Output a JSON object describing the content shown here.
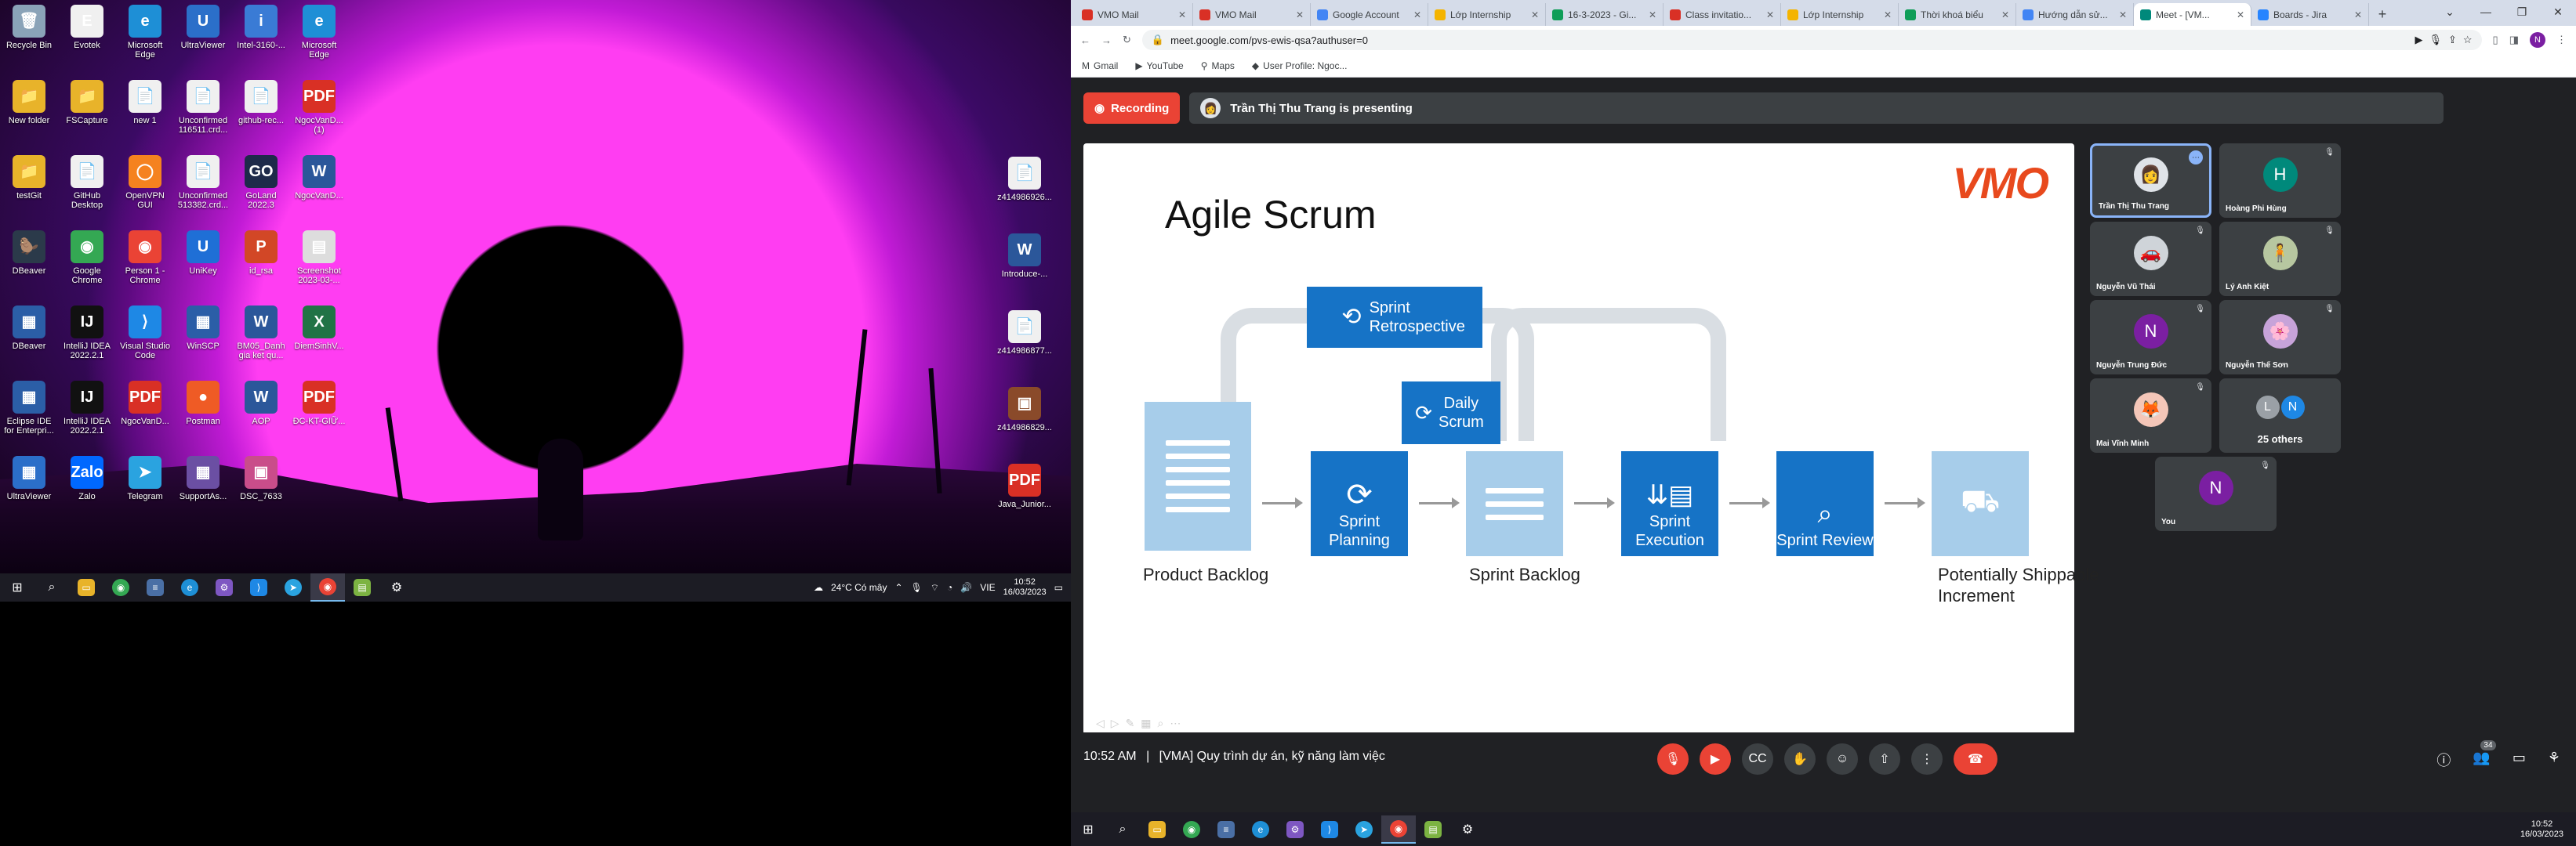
{
  "left_desktop": {
    "icons": [
      {
        "label": "Recycle Bin",
        "glyph": "🗑",
        "color": "#8aa3b8"
      },
      {
        "label": "Evotek",
        "glyph": "E",
        "color": "#f0f0f0"
      },
      {
        "label": "Microsoft Edge",
        "glyph": "e",
        "color": "#1e8fd6"
      },
      {
        "label": "UltraViewer",
        "glyph": "U",
        "color": "#2b6fc9"
      },
      {
        "label": "Intel-3160-...",
        "glyph": "i",
        "color": "#3a7bd5"
      },
      {
        "label": "Microsoft Edge",
        "glyph": "e",
        "color": "#1e8fd6"
      },
      {
        "label": "New folder",
        "glyph": "📁",
        "color": "#e8b32a"
      },
      {
        "label": "FSCapture",
        "glyph": "📁",
        "color": "#e8b32a"
      },
      {
        "label": "new 1",
        "glyph": "📄",
        "color": "#f0f0f0"
      },
      {
        "label": "Unconfirmed 116511.crd...",
        "glyph": "📄",
        "color": "#f0f0f0"
      },
      {
        "label": "github-rec...",
        "glyph": "📄",
        "color": "#f0f0f0"
      },
      {
        "label": "NgocVanD... (1)",
        "glyph": "PDF",
        "color": "#d93025"
      },
      {
        "label": "testGit",
        "glyph": "📁",
        "color": "#e8b32a"
      },
      {
        "label": "GitHub Desktop",
        "glyph": "📄",
        "color": "#f0f0f0"
      },
      {
        "label": "OpenVPN GUI",
        "glyph": "◯",
        "color": "#f5821f"
      },
      {
        "label": "Unconfirmed 513382.crd...",
        "glyph": "📄",
        "color": "#f0f0f0"
      },
      {
        "label": "GoLand 2022.3",
        "glyph": "GO",
        "color": "#1e2a4a"
      },
      {
        "label": "NgocVanD...",
        "glyph": "W",
        "color": "#2b579a"
      },
      {
        "label": "DBeaver",
        "glyph": "🦫",
        "color": "#2b3a4a"
      },
      {
        "label": "Google Chrome",
        "glyph": "◉",
        "color": "#34a853"
      },
      {
        "label": "Person 1 - Chrome",
        "glyph": "◉",
        "color": "#ea4335"
      },
      {
        "label": "UniKey",
        "glyph": "U",
        "color": "#1f6fd6"
      },
      {
        "label": "id_rsa",
        "glyph": "P",
        "color": "#d24726"
      },
      {
        "label": "Screenshot 2023-03-...",
        "glyph": "▤",
        "color": "#dddddd"
      },
      {
        "label": "DBeaver",
        "glyph": "▦",
        "color": "#2b5ea7"
      },
      {
        "label": "IntelliJ IDEA 2022.2.1",
        "glyph": "IJ",
        "color": "#111111"
      },
      {
        "label": "Visual Studio Code",
        "glyph": "⟩",
        "color": "#1e88e5"
      },
      {
        "label": "WinSCP",
        "glyph": "▦",
        "color": "#2b5ea7"
      },
      {
        "label": "BM05_Danh gia ket qu...",
        "glyph": "W",
        "color": "#2b579a"
      },
      {
        "label": "DiemSinhV...",
        "glyph": "X",
        "color": "#217346"
      },
      {
        "label": "Eclipse IDE for Enterpri...",
        "glyph": "▦",
        "color": "#2b5ea7"
      },
      {
        "label": "IntelliJ IDEA 2022.2.1",
        "glyph": "IJ",
        "color": "#111111"
      },
      {
        "label": "NgocVanD...",
        "glyph": "PDF",
        "color": "#d93025"
      },
      {
        "label": "Postman",
        "glyph": "●",
        "color": "#ef5b25"
      },
      {
        "label": "AOP",
        "glyph": "W",
        "color": "#2b579a"
      },
      {
        "label": "ĐC-KT-GIỮ...",
        "glyph": "PDF",
        "color": "#d93025"
      },
      {
        "label": "UltraViewer",
        "glyph": "▦",
        "color": "#2b6fc9"
      },
      {
        "label": "Zalo",
        "glyph": "Zalo",
        "color": "#0068ff"
      },
      {
        "label": "Telegram",
        "glyph": "➤",
        "color": "#2aa3e0"
      },
      {
        "label": "SupportAs...",
        "glyph": "▦",
        "color": "#6b4fa3"
      },
      {
        "label": "DSC_7633",
        "glyph": "▣",
        "color": "#c94d8a"
      }
    ],
    "right_icons": [
      {
        "label": "z414986926...",
        "glyph": "📄",
        "color": "#f0f0f0"
      },
      {
        "label": "Introduce-...",
        "glyph": "W",
        "color": "#2b579a"
      },
      {
        "label": "z414986877...",
        "glyph": "📄",
        "color": "#f0f0f0"
      },
      {
        "label": "z414986829...",
        "glyph": "▣",
        "color": "#8a4a2a"
      },
      {
        "label": "Java_Junior...",
        "glyph": "PDF",
        "color": "#d93025"
      }
    ],
    "taskbar": {
      "weather": "24°C Có mây",
      "lang": "VIE",
      "time": "10:52",
      "date": "16/03/2023"
    }
  },
  "browser": {
    "tabs": [
      {
        "label": "VMO Mail",
        "color": "#d93025",
        "active": false
      },
      {
        "label": "VMO Mail",
        "color": "#d93025",
        "active": false
      },
      {
        "label": "Google Account",
        "color": "#4285f4",
        "active": false
      },
      {
        "label": "Lớp Internship",
        "color": "#f4b400",
        "active": false
      },
      {
        "label": "16-3-2023 - Gi...",
        "color": "#0f9d58",
        "active": false
      },
      {
        "label": "Class invitatio...",
        "color": "#d93025",
        "active": false
      },
      {
        "label": "Lớp Internship",
        "color": "#f4b400",
        "active": false
      },
      {
        "label": "Thời khoá biểu",
        "color": "#0f9d58",
        "active": false
      },
      {
        "label": "Hướng dẫn sử...",
        "color": "#4285f4",
        "active": false
      },
      {
        "label": "Meet - [VM...",
        "color": "#00897b",
        "active": true
      },
      {
        "label": "Boards - Jira",
        "color": "#2684ff",
        "active": false
      }
    ],
    "url": "meet.google.com/pvs-ewis-qsa?authuser=0",
    "bookmarks": [
      {
        "label": "Gmail",
        "glyph": "M"
      },
      {
        "label": "YouTube",
        "glyph": "▶"
      },
      {
        "label": "Maps",
        "glyph": "⚲"
      },
      {
        "label": "User Profile: Ngoc...",
        "glyph": "◆"
      }
    ]
  },
  "meet": {
    "recording_label": "Recording",
    "presenting_label": "Trần Thị Thu Trang is presenting",
    "slide": {
      "title": "Agile Scrum",
      "logo": "VMO",
      "retro": "Sprint Retrospective",
      "daily": "Daily Scrum",
      "planning": "Sprint Planning",
      "execution": "Sprint Execution",
      "review": "Sprint Review",
      "product_backlog": "Product Backlog",
      "sprint_backlog": "Sprint Backlog",
      "increment": "Potentially Shippable Increment"
    },
    "participants": [
      {
        "name": "Trần Thị Thu Trang",
        "avatar": "👩",
        "avatar_color": "#dfe3e8",
        "selected": true
      },
      {
        "name": "Hoàng Phi Hùng",
        "avatar": "H",
        "avatar_color": "#00897b"
      },
      {
        "name": "Nguyễn Vũ Thái",
        "avatar": "🚗",
        "avatar_color": "#cfd4d9"
      },
      {
        "name": "Lý Anh Kiệt",
        "avatar": "🧍",
        "avatar_color": "#b7c7a0"
      },
      {
        "name": "Nguyễn Trung Đức",
        "avatar": "N",
        "avatar_color": "#7b1fa2"
      },
      {
        "name": "Nguyễn Thế Sơn",
        "avatar": "🌸",
        "avatar_color": "#c7a3d9"
      },
      {
        "name": "Mai Vĩnh Minh",
        "avatar": "🦊",
        "avatar_color": "#f4c6b8"
      },
      {
        "name": "25 others",
        "avatar": "",
        "avatar_color": "#3c4043"
      },
      {
        "name": "You",
        "avatar": "N",
        "avatar_color": "#7b1fa2"
      }
    ],
    "others_initials": [
      "L",
      "N"
    ],
    "time": "10:52 AM",
    "meeting_title": "[VMA] Quy trình dự án, kỹ năng làm việc",
    "people_count": "34"
  },
  "right_taskbar": {
    "time": "10:52",
    "date": "16/03/2023"
  }
}
